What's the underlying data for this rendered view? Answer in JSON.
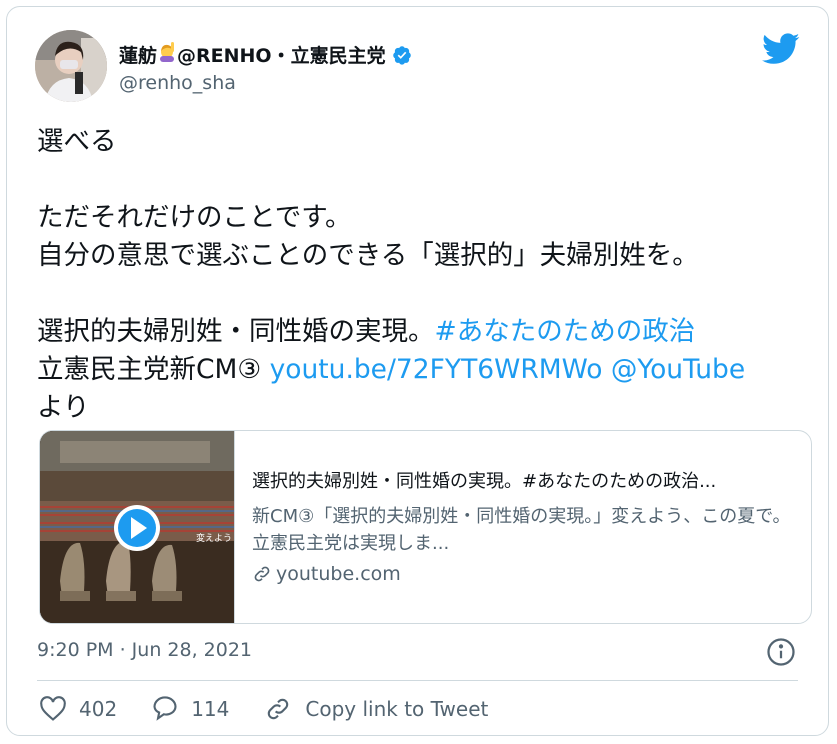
{
  "author": {
    "name_prefix": "蓮舫",
    "name_suffix": "@RENHO・立憲民主党",
    "handle": "@renho_sha"
  },
  "icons": {
    "verified": "verified-badge-icon",
    "brand": "twitter-bird-icon",
    "like": "heart-icon",
    "reply": "reply-bubble-icon",
    "copy": "link-icon",
    "info": "info-icon",
    "play": "play-icon"
  },
  "colors": {
    "accent": "#1d9bf0",
    "text": "#0f1419",
    "muted": "#536471",
    "border": "#cfd9de"
  },
  "tweet": {
    "line1": "選べる",
    "line2": "ただそれだけのことです。",
    "line3": "自分の意思で選ぶことのできる「選択的」夫婦別姓を。",
    "line4_text": "選択的夫婦別姓・同性婚の実現。",
    "line4_hashtag": "#あなたのための政治",
    "line5_text": "立憲民主党新CM③ ",
    "line5_link": "youtu.be/72FYT6WRMWo",
    "line5_mention": "@YouTube",
    "line6": "より"
  },
  "link_card": {
    "title": "選択的夫婦別姓・同性婚の実現。#あなたのための政治...",
    "description": "新CM③「選択的夫婦別姓・同性婚の実現。」変えよう、この夏で。立憲民主党は実現しま...",
    "domain": "youtube.com",
    "thumb_caption": "変えよう"
  },
  "timestamp": "9:20 PM · Jun 28, 2021",
  "actions": {
    "likes": "402",
    "replies": "114",
    "copy_label": "Copy link to Tweet"
  }
}
